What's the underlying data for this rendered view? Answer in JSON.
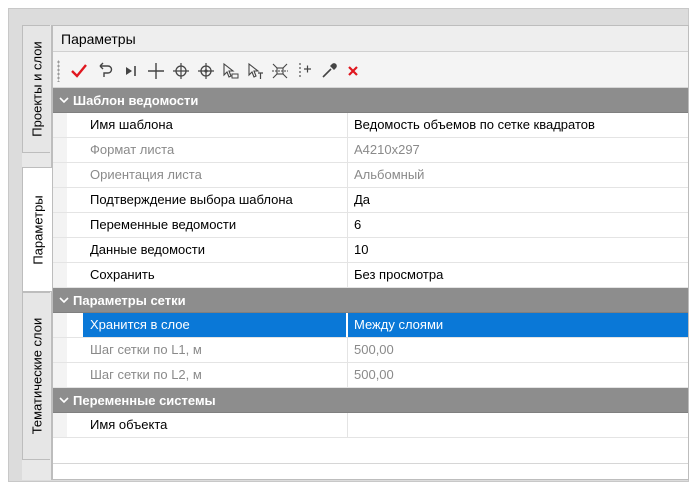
{
  "side_tabs": [
    {
      "label": "Проекты и слои",
      "active": false
    },
    {
      "label": "Параметры",
      "active": true
    },
    {
      "label": "Тематические слои",
      "active": false
    }
  ],
  "panel": {
    "title": "Параметры"
  },
  "toolbar": {
    "icons": [
      "checkmark-icon",
      "undo-icon",
      "step-icon",
      "add-cross-icon",
      "crosshair-circle-icon",
      "crosshair-move-icon",
      "select-polygon-icon",
      "select-text-icon",
      "snap-center-icon",
      "split-line-icon",
      "eyedropper-icon",
      "delete-icon"
    ],
    "colors": {
      "checkmark": "#e0171f",
      "delete": "#e0171f"
    }
  },
  "sections": [
    {
      "title": "Шаблон ведомости",
      "rows": [
        {
          "name": "Имя шаблона",
          "value": "Ведомость объемов по сетке квадратов",
          "disabled": false
        },
        {
          "name": "Формат листа",
          "value": "А4210x297",
          "disabled": true
        },
        {
          "name": "Ориентация листа",
          "value": "Альбомный",
          "disabled": true
        },
        {
          "name": "Подтверждение выбора шаблона",
          "value": "Да",
          "disabled": false
        },
        {
          "name": "Переменные ведомости",
          "value": "6",
          "disabled": false
        },
        {
          "name": "Данные ведомости",
          "value": "10",
          "disabled": false
        },
        {
          "name": "Сохранить",
          "value": "Без просмотра",
          "disabled": false
        }
      ]
    },
    {
      "title": "Параметры сетки",
      "rows": [
        {
          "name": "Хранится в слое",
          "value": "Между слоями",
          "disabled": false,
          "selected": true
        },
        {
          "name": "Шаг сетки по L1, м",
          "value": "500,00",
          "disabled": true
        },
        {
          "name": "Шаг сетки по L2, м",
          "value": "500,00",
          "disabled": true
        }
      ]
    },
    {
      "title": "Переменные системы",
      "rows": [
        {
          "name": "Имя объекта",
          "value": "",
          "disabled": false
        }
      ]
    }
  ],
  "colors": {
    "selection": "#0a78d7",
    "section_header": "#8d8d8d"
  }
}
